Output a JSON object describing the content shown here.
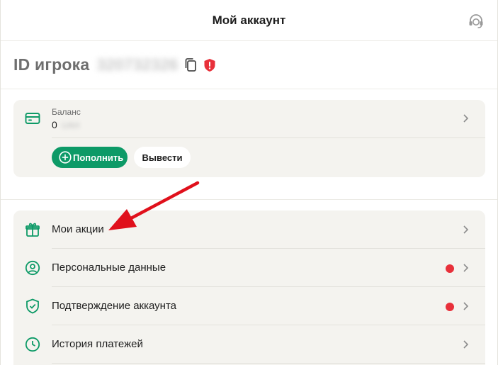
{
  "header": {
    "title": "Мой аккаунт",
    "support_icon": "headset-icon"
  },
  "player": {
    "id_label": "ID игрока",
    "id_value": "320732326",
    "copy_icon": "copy-icon",
    "warning_icon": "shield-alert-icon",
    "warning_color": "#e8303a"
  },
  "balance": {
    "label": "Баланс",
    "amount": "0",
    "currency": "UAH",
    "deposit_label": "Пополнить",
    "withdraw_label": "Вывести"
  },
  "menu": {
    "items": [
      {
        "label": "Мои акции",
        "icon": "gift-icon",
        "alert": false
      },
      {
        "label": "Персональные данные",
        "icon": "user-circle-icon",
        "alert": true
      },
      {
        "label": "Подтверждение аккаунта",
        "icon": "shield-check-icon",
        "alert": true
      },
      {
        "label": "История платежей",
        "icon": "clock-icon",
        "alert": false
      }
    ]
  },
  "colors": {
    "accent": "#0d9a67",
    "alert": "#e8303a",
    "card_bg": "#f4f3ef",
    "annotation_arrow": "#e0101b"
  }
}
